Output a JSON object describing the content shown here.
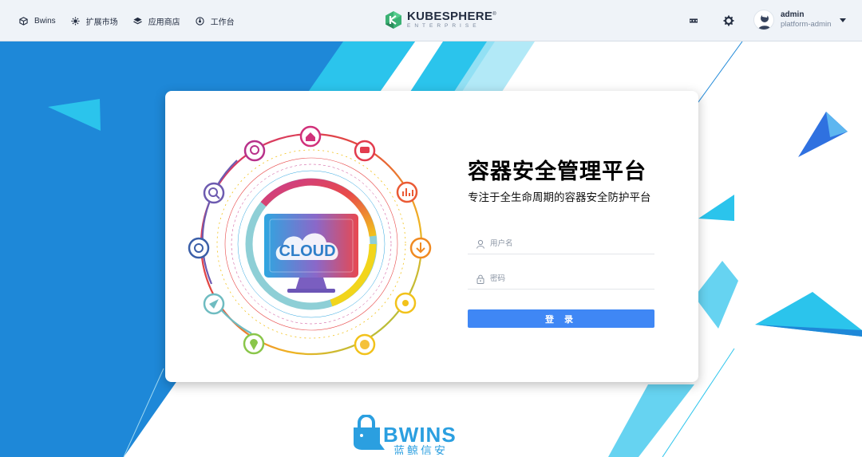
{
  "nav": {
    "items": [
      {
        "label": "Bwins",
        "icon": "cube-icon"
      },
      {
        "label": "扩展市场",
        "icon": "gear-puzzle-icon"
      },
      {
        "label": "应用商店",
        "icon": "layers-icon"
      },
      {
        "label": "工作台",
        "icon": "dashboard-icon"
      }
    ]
  },
  "logo": {
    "main": "KUBESPHERE",
    "registered": "®",
    "sub": "ENTERPRISE"
  },
  "header_tools": [
    {
      "icon": "more-dots-icon"
    },
    {
      "icon": "settings-gear-icon"
    }
  ],
  "user": {
    "name": "admin",
    "role": "platform-admin",
    "avatar": "user-avatar-icon"
  },
  "login": {
    "title": "容器安全管理平台",
    "subtitle": "专注于全生命周期的容器安全防护平台",
    "username_placeholder": "用户名",
    "password_placeholder": "密码",
    "submit_label": "登 录"
  },
  "illustration": {
    "monitor_text": "CLOUD"
  },
  "brand": {
    "en": "BWINS",
    "cn": "蓝鲸信安"
  },
  "colors": {
    "primary_button": "#3f87f5",
    "background_blue": "#1e88d8",
    "accent_cyan": "#2bc4ec",
    "topbar": "#eff3f8"
  }
}
